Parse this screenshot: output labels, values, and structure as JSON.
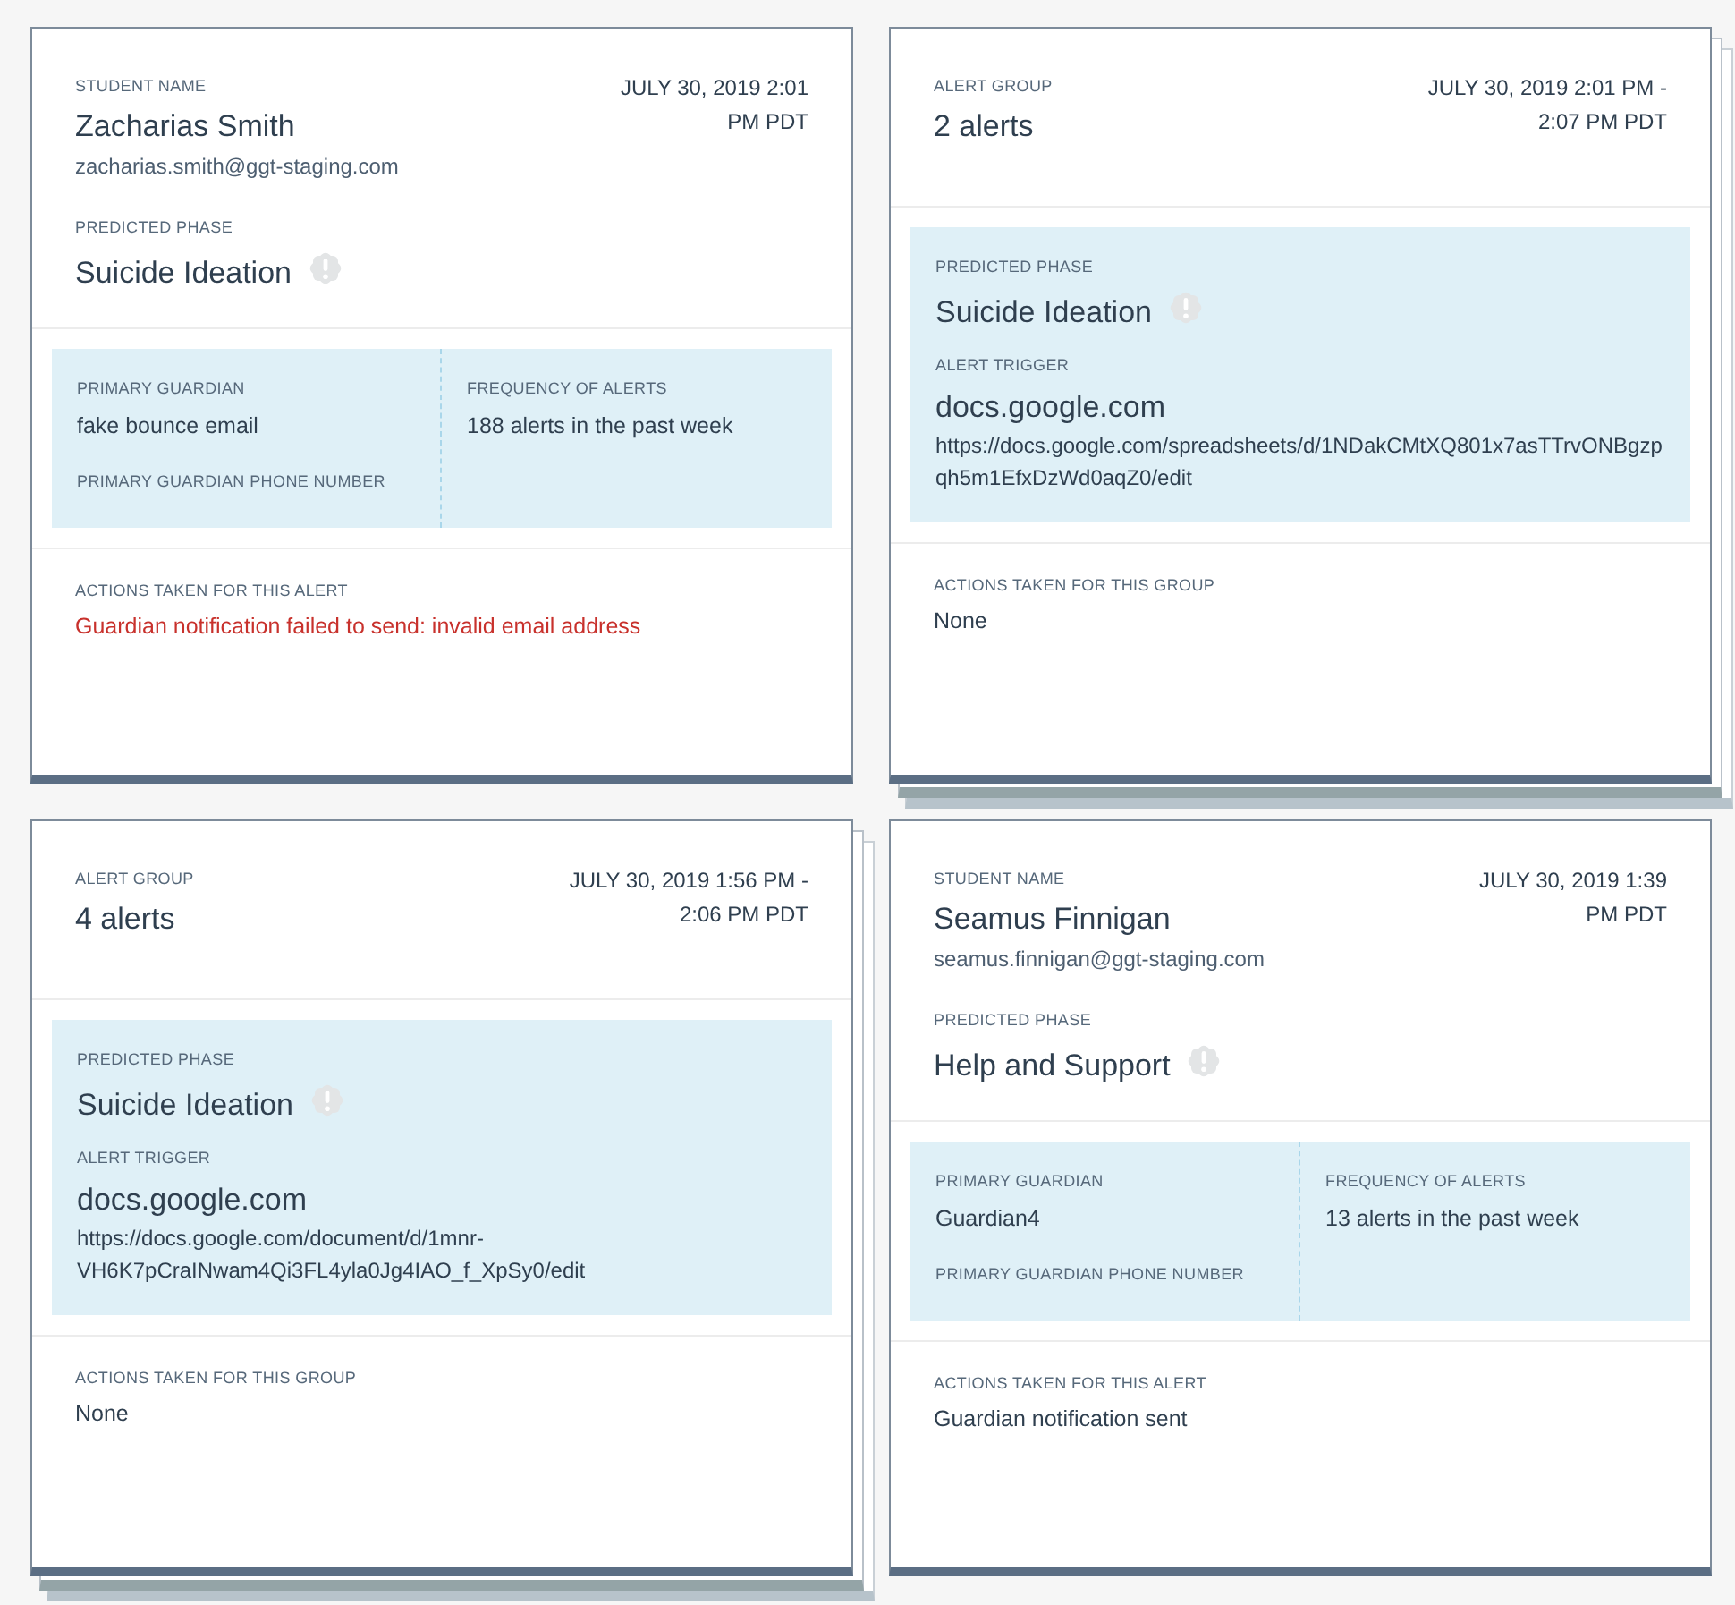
{
  "cards": [
    {
      "kind": "student",
      "header": {
        "label": "STUDENT NAME",
        "title": "Zacharias Smith",
        "email": "zacharias.smith@ggt-staging.com",
        "date": "JULY 30, 2019 2:01\nPM PDT"
      },
      "phase": {
        "label": "PREDICTED PHASE",
        "value": "Suicide Ideation"
      },
      "guardian": {
        "label": "PRIMARY GUARDIAN",
        "value": "fake bounce email",
        "phone_label": "PRIMARY GUARDIAN PHONE NUMBER"
      },
      "frequency": {
        "label": "FREQUENCY OF ALERTS",
        "value": "188 alerts in the past week"
      },
      "actions": {
        "label": "ACTIONS TAKEN FOR THIS ALERT",
        "value": "Guardian notification failed to send: invalid email address",
        "failed": true
      }
    },
    {
      "kind": "group",
      "header": {
        "label": "ALERT GROUP",
        "title": "2 alerts",
        "date": "JULY 30, 2019 2:01 PM -\n2:07 PM PDT"
      },
      "phase": {
        "label": "PREDICTED PHASE",
        "value": "Suicide Ideation"
      },
      "trigger": {
        "label": "ALERT TRIGGER",
        "domain": "docs.google.com",
        "url": "https://docs.google.com/spreadsheets/d/1NDakCMtXQ801x7asTTrvONBgzpqh5m1EfxDzWd0aqZ0/edit"
      },
      "actions": {
        "label": "ACTIONS TAKEN FOR THIS GROUP",
        "value": "None",
        "failed": false
      }
    },
    {
      "kind": "group",
      "header": {
        "label": "ALERT GROUP",
        "title": "4 alerts",
        "date": "JULY 30, 2019 1:56 PM -\n2:06 PM PDT"
      },
      "phase": {
        "label": "PREDICTED PHASE",
        "value": "Suicide Ideation"
      },
      "trigger": {
        "label": "ALERT TRIGGER",
        "domain": "docs.google.com",
        "url": "https://docs.google.com/document/d/1mnr-VH6K7pCraINwam4Qi3FL4yla0Jg4IAO_f_XpSy0/edit"
      },
      "actions": {
        "label": "ACTIONS TAKEN FOR THIS GROUP",
        "value": "None",
        "failed": false
      }
    },
    {
      "kind": "student",
      "header": {
        "label": "STUDENT NAME",
        "title": "Seamus Finnigan",
        "email": "seamus.finnigan@ggt-staging.com",
        "date": "JULY 30, 2019 1:39\nPM PDT"
      },
      "phase": {
        "label": "PREDICTED PHASE",
        "value": "Help and Support"
      },
      "guardian": {
        "label": "PRIMARY GUARDIAN",
        "value": "Guardian4",
        "phone_label": "PRIMARY GUARDIAN PHONE NUMBER"
      },
      "frequency": {
        "label": "FREQUENCY OF ALERTS",
        "value": "13 alerts in the past week"
      },
      "actions": {
        "label": "ACTIONS TAKEN FOR THIS ALERT",
        "value": "Guardian notification sent",
        "failed": false
      }
    }
  ]
}
